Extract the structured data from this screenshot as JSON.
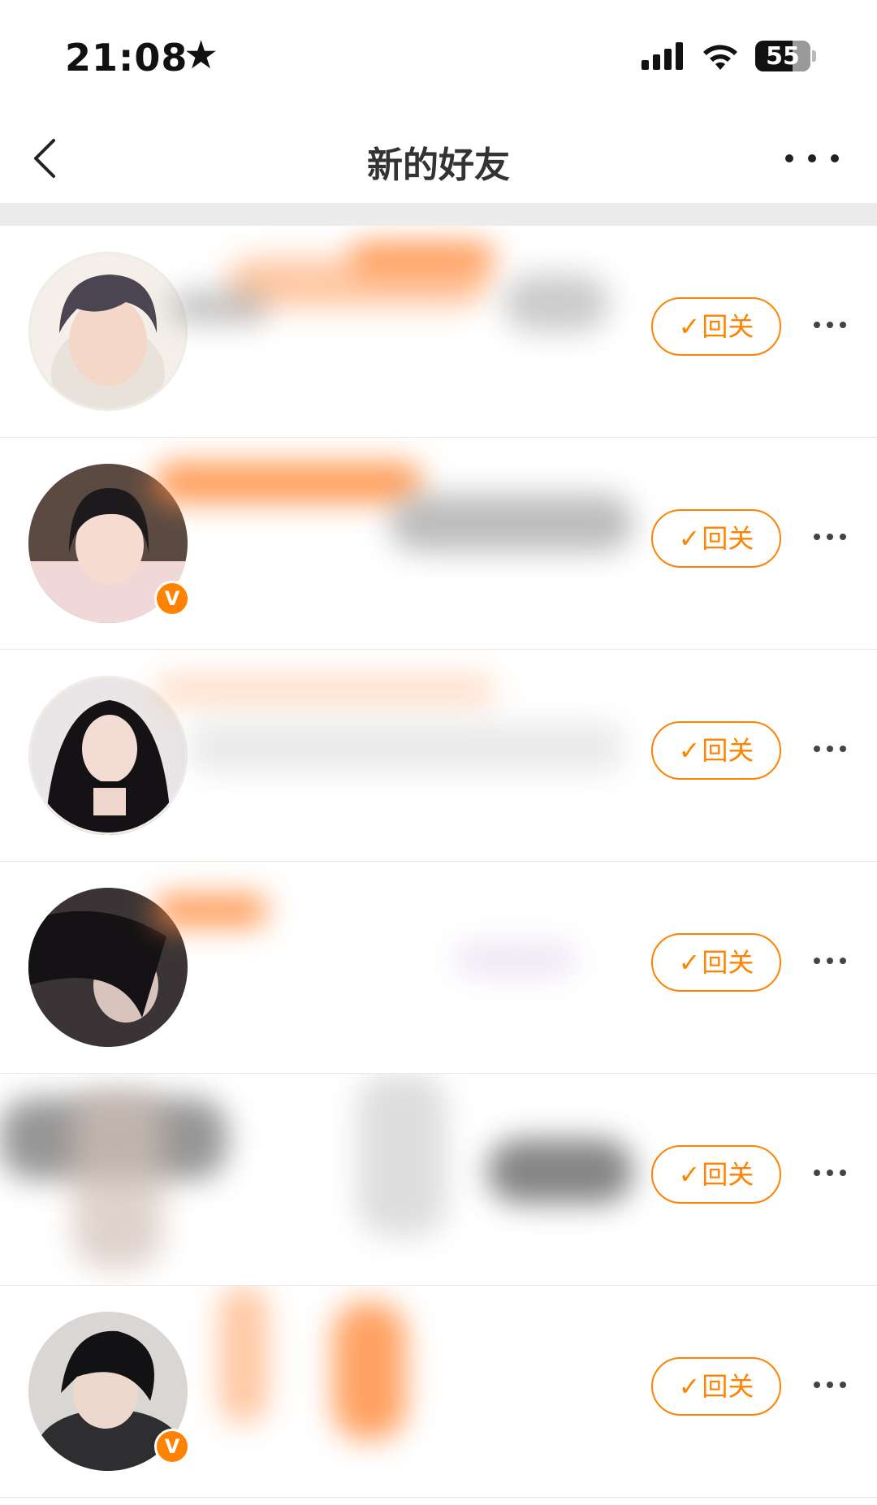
{
  "status_bar": {
    "time": "21:08",
    "battery": "55"
  },
  "nav": {
    "title": "新的好友"
  },
  "accent_color": "#ff8200",
  "icons": {
    "back": "chevron-left-icon",
    "more": "ellipsis-icon",
    "check": "checkmark-icon",
    "vip": "v-badge-icon"
  },
  "rows": [
    {
      "follow_label": "回关",
      "verified": false
    },
    {
      "follow_label": "回关",
      "verified": true
    },
    {
      "follow_label": "回关",
      "verified": false
    },
    {
      "follow_label": "回关",
      "verified": false
    },
    {
      "follow_label": "回关",
      "verified": false
    },
    {
      "follow_label": "回关",
      "verified": true
    }
  ],
  "vip_label": "V"
}
